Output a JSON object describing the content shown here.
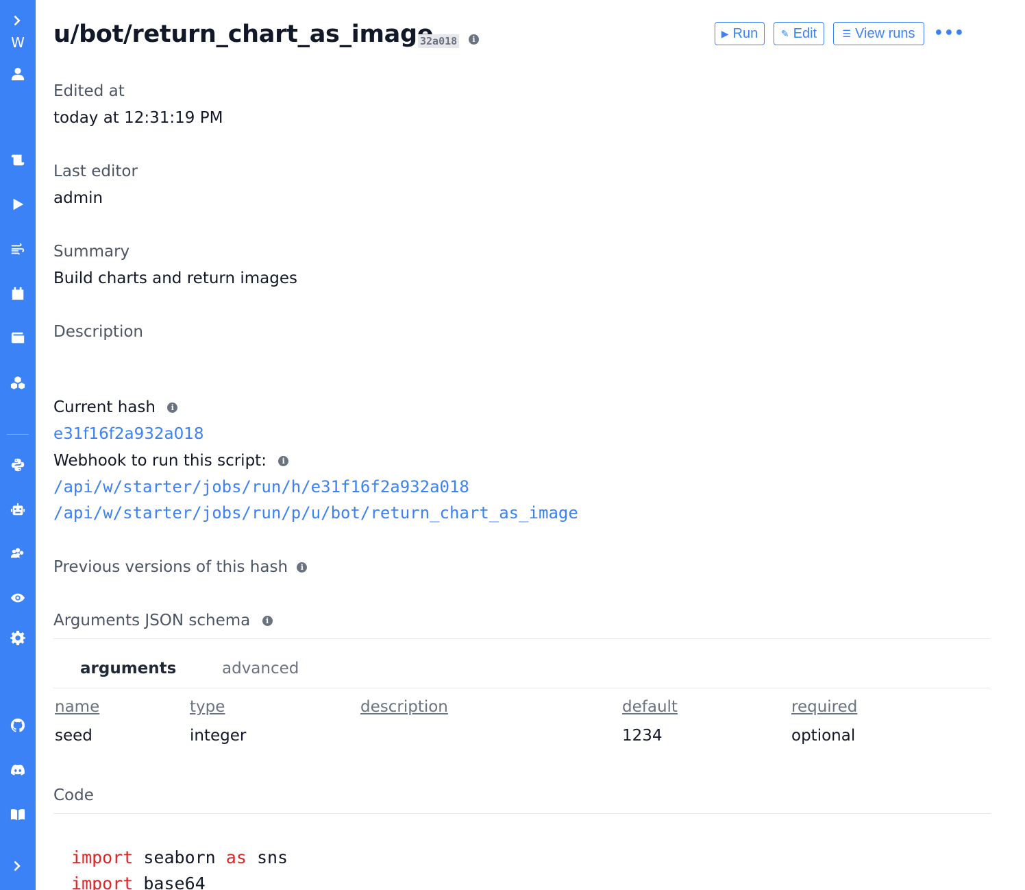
{
  "sidebar": {
    "workspace_letter": "W",
    "icons": [
      "chevron-right-icon",
      "user-icon",
      "scroll-icon",
      "play-icon",
      "wind-icon",
      "calendar-icon",
      "wallet-icon",
      "cubes-icon",
      "python-icon",
      "robot-icon",
      "users-cog-icon",
      "eye-icon",
      "gear-icon",
      "github-icon",
      "discord-icon",
      "book-icon",
      "chevron-right-icon"
    ]
  },
  "header": {
    "title": "u/bot/return_chart_as_image",
    "hash_short": "32a018",
    "buttons": {
      "run": "Run",
      "edit": "Edit",
      "view_runs": "View runs",
      "more": "•••"
    }
  },
  "details": {
    "edited_at_label": "Edited at",
    "edited_at_value": "today at 12:31:19 PM",
    "last_editor_label": "Last editor",
    "last_editor_value": "admin",
    "summary_label": "Summary",
    "summary_value": "Build charts and return images",
    "description_label": "Description",
    "current_hash_label": "Current hash",
    "current_hash_value": "e31f16f2a932a018",
    "webhook_label": "Webhook to run this script:",
    "webhook_hash_url": "/api/w/starter/jobs/run/h/e31f16f2a932a018",
    "webhook_path_url": "/api/w/starter/jobs/run/p/u/bot/return_chart_as_image",
    "previous_versions_label": "Previous versions of this hash",
    "arguments_schema_label": "Arguments JSON schema"
  },
  "schema": {
    "tabs": [
      "arguments",
      "advanced"
    ],
    "columns": [
      "name",
      "type",
      "description",
      "default",
      "required"
    ],
    "rows": [
      {
        "name": "seed",
        "type": "integer",
        "description": "",
        "default": "1234",
        "required": "optional"
      }
    ]
  },
  "code": {
    "label": "Code",
    "lines": [
      {
        "kw": "import",
        "rest": " seaborn ",
        "kw2": "as",
        "rest2": " sns"
      },
      {
        "kw": "import",
        "rest": " base64",
        "kw2": "",
        "rest2": ""
      }
    ]
  },
  "colors": {
    "accent": "#3b82f6",
    "keyword": "#dc2626"
  }
}
